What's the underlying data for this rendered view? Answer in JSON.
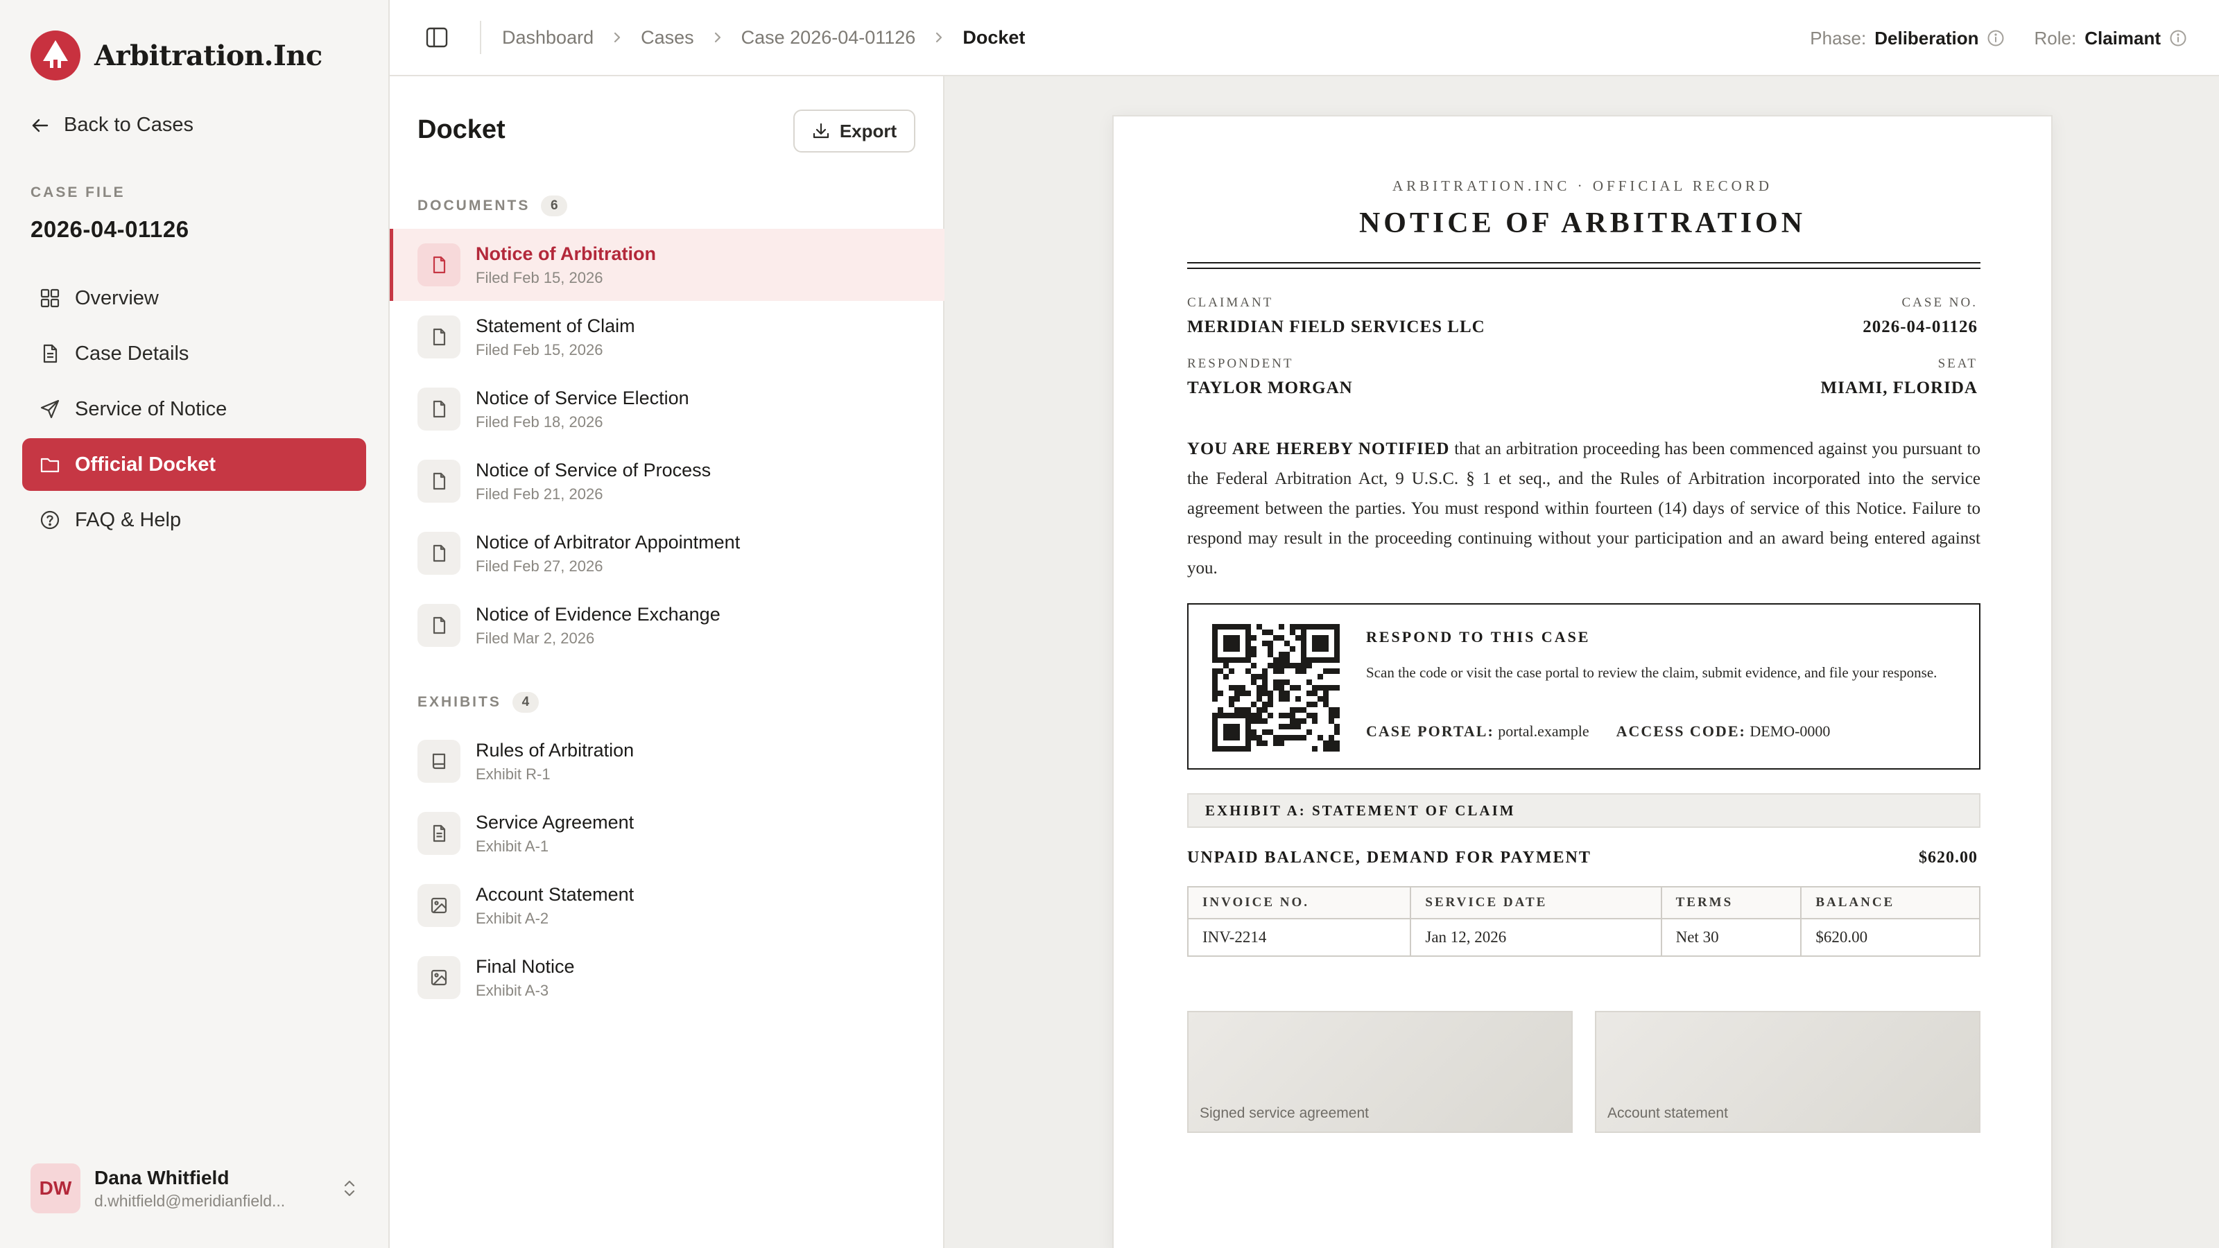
{
  "brand": {
    "name": "Arbitration.Inc"
  },
  "sidebar": {
    "back_label": "Back to Cases",
    "case_label": "CASE FILE",
    "case_number": "2026-04-01126",
    "items": [
      {
        "label": "Overview",
        "icon": "grid-icon"
      },
      {
        "label": "Case Details",
        "icon": "document-icon"
      },
      {
        "label": "Service of Notice",
        "icon": "send-icon"
      },
      {
        "label": "Official Docket",
        "icon": "folder-icon",
        "active": true
      },
      {
        "label": "FAQ & Help",
        "icon": "help-circle-icon"
      }
    ],
    "user": {
      "initials": "DW",
      "name": "Dana Whitfield",
      "email": "d.whitfield@meridianfield..."
    }
  },
  "topbar": {
    "breadcrumbs": [
      "Dashboard",
      "Cases",
      "Case 2026-04-01126",
      "Docket"
    ],
    "phase_label": "Phase:",
    "phase_value": "Deliberation",
    "role_label": "Role:",
    "role_value": "Claimant"
  },
  "docket": {
    "title": "Docket",
    "export_label": "Export",
    "documents_label": "DOCUMENTS",
    "documents_count": "6",
    "documents": [
      {
        "title": "Notice of Arbitration",
        "sub": "Filed Feb 15, 2026",
        "icon": "file-icon",
        "active": true
      },
      {
        "title": "Statement of Claim",
        "sub": "Filed Feb 15, 2026",
        "icon": "file-icon"
      },
      {
        "title": "Notice of Service Election",
        "sub": "Filed Feb 18, 2026",
        "icon": "file-icon"
      },
      {
        "title": "Notice of Service of Process",
        "sub": "Filed Feb 21, 2026",
        "icon": "file-icon"
      },
      {
        "title": "Notice of Arbitrator Appointment",
        "sub": "Filed Feb 27, 2026",
        "icon": "file-icon"
      },
      {
        "title": "Notice of Evidence Exchange",
        "sub": "Filed Mar 2, 2026",
        "icon": "file-icon"
      }
    ],
    "exhibits_label": "EXHIBITS",
    "exhibits_count": "4",
    "exhibits": [
      {
        "title": "Rules of Arbitration",
        "sub": "Exhibit R-1",
        "icon": "book-icon"
      },
      {
        "title": "Service Agreement",
        "sub": "Exhibit A-1",
        "icon": "file-text-icon"
      },
      {
        "title": "Account Statement",
        "sub": "Exhibit A-2",
        "icon": "image-icon"
      },
      {
        "title": "Final Notice",
        "sub": "Exhibit A-3",
        "icon": "image-icon"
      }
    ]
  },
  "notice": {
    "kicker": "ARBITRATION.INC  ·  OFFICIAL RECORD",
    "title": "NOTICE OF ARBITRATION",
    "claimant_label": "CLAIMANT",
    "claimant": "MERIDIAN FIELD SERVICES LLC",
    "case_no_label": "CASE NO.",
    "case_no": "2026-04-01126",
    "respondent_label": "RESPONDENT",
    "respondent": "TAYLOR MORGAN",
    "seat_label": "SEAT",
    "seat": "MIAMI, FLORIDA",
    "body_lead": "YOU ARE HEREBY NOTIFIED",
    "body_rest": " that an arbitration proceeding has been commenced against you pursuant to the Federal Arbitration Act, 9 U.S.C. § 1 et seq., and the Rules of Arbitration incorporated into the service agreement between the parties. You must respond within fourteen (14) days of service of this Notice. Failure to respond may result in the proceeding continuing without your participation and an award being entered against you.",
    "respond_title": "RESPOND TO THIS CASE",
    "respond_text": "Scan the code or visit the case portal to review the claim, submit evidence, and file your response.",
    "portal_label": "CASE PORTAL:",
    "portal_value": "portal.example",
    "access_label": "ACCESS CODE:",
    "access_value": "DEMO-0000",
    "exhibit_heading": "EXHIBIT A: STATEMENT OF CLAIM",
    "demand_title": "UNPAID BALANCE, DEMAND FOR PAYMENT",
    "demand_amount": "$620.00",
    "table": {
      "headers": [
        "INVOICE NO.",
        "SERVICE DATE",
        "TERMS",
        "BALANCE"
      ],
      "rows": [
        [
          "INV-2214",
          "Jan 12, 2026",
          "Net 30",
          "$620.00"
        ]
      ]
    },
    "thumbs": [
      "Signed service agreement",
      "Account statement"
    ]
  },
  "colors": {
    "accent": "#c63744",
    "accent_dark": "#b3283a",
    "accent_soft": "#fbeceb"
  }
}
